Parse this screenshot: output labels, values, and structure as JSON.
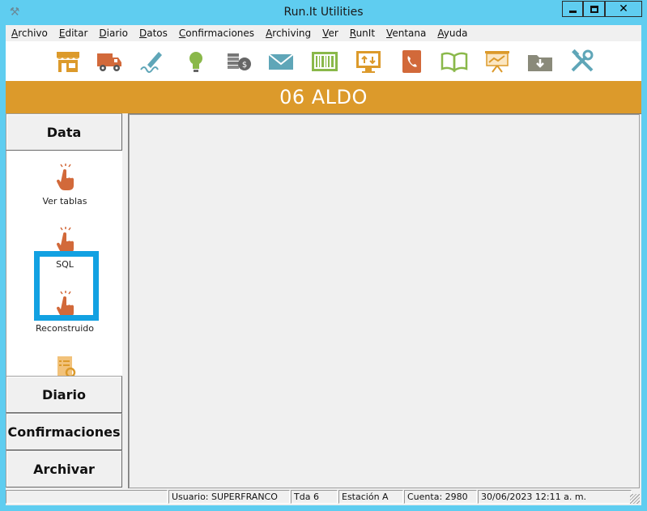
{
  "window": {
    "title": "Run.It Utilities",
    "close_glyph": "✕"
  },
  "menu": [
    "Archivo",
    "Editar",
    "Diario",
    "Datos",
    "Confirmaciones",
    "Archiving",
    "Ver",
    "RunIt",
    "Ventana",
    "Ayuda"
  ],
  "toolbar": {
    "icons": [
      "store-icon",
      "truck-icon",
      "signature-icon",
      "lightbulb-icon",
      "coins-icon",
      "mail-icon",
      "barcode-icon",
      "monitor-transfer-icon",
      "phonebook-icon",
      "book-icon",
      "presentation-icon",
      "download-folder-icon",
      "tools-icon"
    ]
  },
  "banner": {
    "text": "06 ALDO"
  },
  "left_pane": {
    "sections": {
      "data": "Data",
      "diario": "Diario",
      "confirmaciones": "Confirmaciones",
      "archivar": "Archivar"
    },
    "items": [
      {
        "label": "Ver tablas"
      },
      {
        "label": "SQL"
      },
      {
        "label": "Reconstruido"
      }
    ],
    "selected": "SQL"
  },
  "status": {
    "usuario": "Usuario: SUPERFRANCO",
    "tienda": "Tda 6",
    "estacion": "Estación A",
    "cuenta": "Cuenta: 2980",
    "datetime": "30/06/2023 12:11 a. m."
  },
  "colors": {
    "title_bar": "#5fcdf0",
    "banner": "#dc9a2b",
    "selection": "#12a1e2",
    "hand_icon": "#d2693a"
  }
}
